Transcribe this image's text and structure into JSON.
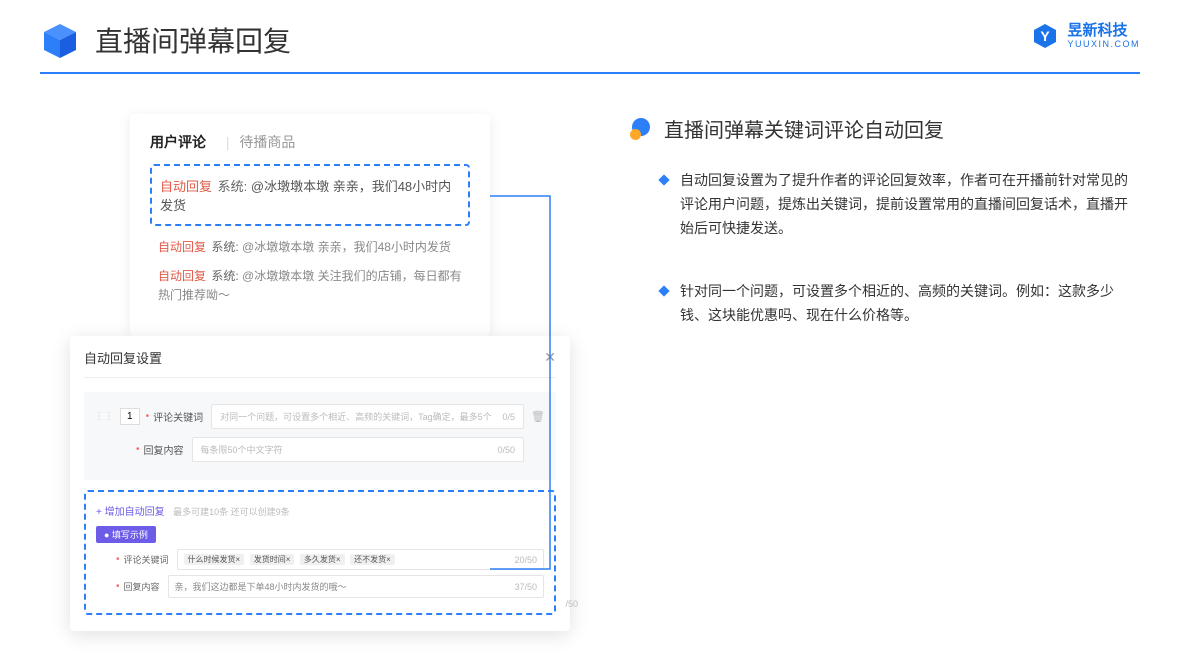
{
  "header": {
    "title": "直播间弹幕回复",
    "brandCN": "昱新科技",
    "brandEN": "YUUXIN.COM"
  },
  "cardA": {
    "tabActive": "用户评论",
    "tabInactive": "待播商品",
    "highlightTag": "自动回复",
    "highlightSys": "系统:",
    "highlightText": "@冰墩墩本墩 亲亲，我们48小时内发货",
    "row1Tag": "自动回复",
    "row1Sys": "系统:",
    "row1Text": "@冰墩墩本墩 亲亲，我们48小时内发货",
    "row2Tag": "自动回复",
    "row2Sys": "系统:",
    "row2Text": "@冰墩墩本墩 关注我们的店铺，每日都有热门推荐呦～"
  },
  "cardB": {
    "title": "自动回复设置",
    "num": "1",
    "labelKeyword": "评论关键词",
    "placeholderKeyword": "对同一个问题，可设置多个相近、高频的关键词，Tag确定，最多5个",
    "countKeyword": "0/5",
    "labelContent": "回复内容",
    "placeholderContent": "每条限50个中文字符",
    "countContent": "0/50",
    "addText": "+ 增加自动回复",
    "addHint": "最多可建10条 还可以创建9条",
    "exampleBadge": "● 填写示例",
    "exKeywordLabel": "评论关键词",
    "exTags": [
      "什么时候发货×",
      "发货时间×",
      "多久发货×",
      "还不发货×"
    ],
    "exKwCount": "20/50",
    "exContentLabel": "回复内容",
    "exContentValue": "亲，我们这边都是下单48小时内发货的哦～",
    "exContentCount": "37/50",
    "extraCount": "/50"
  },
  "right": {
    "title": "直播间弹幕关键词评论自动回复",
    "b1": "自动回复设置为了提升作者的评论回复效率，作者可在开播前针对常见的评论用户问题，提炼出关键词，提前设置常用的直播间回复话术，直播开始后可快捷发送。",
    "b2": "针对同一个问题，可设置多个相近的、高频的关键词。例如：这款多少钱、这块能优惠吗、现在什么价格等。"
  }
}
